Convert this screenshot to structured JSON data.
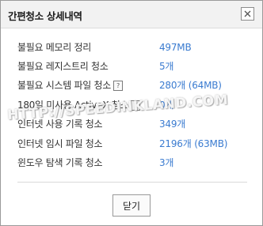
{
  "dialog": {
    "title": "간편청소 상세내역",
    "close_icon": "close-icon"
  },
  "rows": [
    {
      "label": "불필요 메모리 정리",
      "value": "497MB",
      "help": false
    },
    {
      "label": "불필요 레지스트리 청소",
      "value": "5개",
      "help": false
    },
    {
      "label": "불필요 시스템 파일 청소",
      "value": "280개 (64MB)",
      "help": true
    },
    {
      "label": "180일 미사용 ActiveX 청소",
      "value": "0개",
      "help": true
    },
    {
      "label": "인터넷 사용 기록 청소",
      "value": "349개",
      "help": false
    },
    {
      "label": "인터넷 임시 파일 청소",
      "value": "2196개 (63MB)",
      "help": false
    },
    {
      "label": "윈도우 탐색 기록 청소",
      "value": "3개",
      "help": false
    }
  ],
  "help_glyph": "?",
  "button": {
    "close_label": "닫기"
  },
  "watermark": {
    "text": "HTTP://SPEEDINKLAND.COM"
  },
  "colors": {
    "value": "#3a7bd0",
    "label": "#333333"
  }
}
